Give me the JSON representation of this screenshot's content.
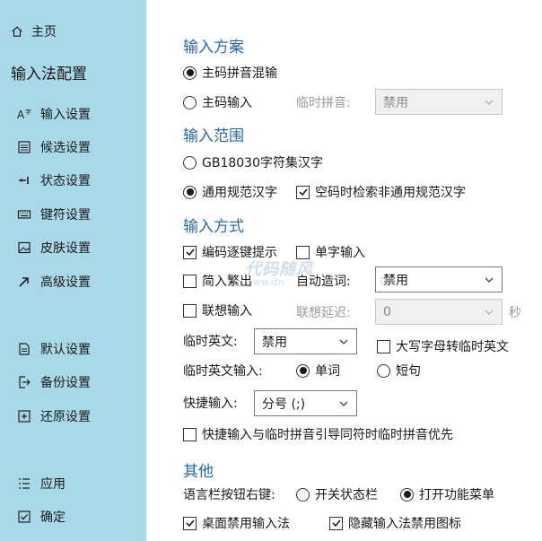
{
  "sidebar": {
    "home": "主页",
    "title": "输入法配置",
    "items": [
      {
        "label": "输入设置",
        "icon": "font-input-icon"
      },
      {
        "label": "候选设置",
        "icon": "list-icon"
      },
      {
        "label": "状态设置",
        "icon": "status-icon"
      },
      {
        "label": "键符设置",
        "icon": "keyboard-icon"
      },
      {
        "label": "皮肤设置",
        "icon": "image-icon"
      },
      {
        "label": "高级设置",
        "icon": "arrow-icon"
      }
    ],
    "items2": [
      {
        "label": "默认设置",
        "icon": "doc-icon"
      },
      {
        "label": "备份设置",
        "icon": "export-icon"
      },
      {
        "label": "还原设置",
        "icon": "import-icon"
      }
    ],
    "actions": [
      {
        "label": "应用",
        "icon": "apply-icon"
      },
      {
        "label": "确定",
        "icon": "confirm-icon"
      }
    ]
  },
  "main": {
    "scheme": {
      "title": "输入方案",
      "opt1": "主码拼音混输",
      "opt2": "主码输入",
      "temp_pinyin_label": "临时拼音:",
      "temp_pinyin_value": "禁用"
    },
    "range": {
      "title": "输入范围",
      "opt1": "GB18030字符集汉字",
      "opt2": "通用规范汉字",
      "check": "空码时检索非通用规范汉字"
    },
    "method": {
      "title": "输入方式",
      "encode_hint": "编码逐键提示",
      "single_char": "单字输入",
      "simp_trad": "简入繁出",
      "auto_word_label": "自动造词:",
      "auto_word_value": "禁用",
      "assoc": "联想输入",
      "assoc_delay_label": "联想延迟:",
      "assoc_delay_value": "0",
      "assoc_delay_unit": "秒",
      "temp_en_label": "临时英文:",
      "temp_en_value": "禁用",
      "caps_to_en": "大写字母转临时英文",
      "temp_en_input_label": "临时英文输入:",
      "temp_en_opt1": "单词",
      "temp_en_opt2": "短句",
      "quick_label": "快捷输入:",
      "quick_value": "分号 (;)",
      "quick_priority": "快捷输入与临时拼音引导同符时临时拼音优先"
    },
    "other": {
      "title": "其他",
      "langbar_label": "语言栏按钮右键:",
      "langbar_opt1": "开关状态栏",
      "langbar_opt2": "打开功能菜单",
      "desktop_disable": "桌面禁用输入法",
      "hide_disabled_icon": "隐藏输入法禁用图标"
    }
  },
  "watermark": {
    "text": "代码随风",
    "sub": "www.dn"
  }
}
